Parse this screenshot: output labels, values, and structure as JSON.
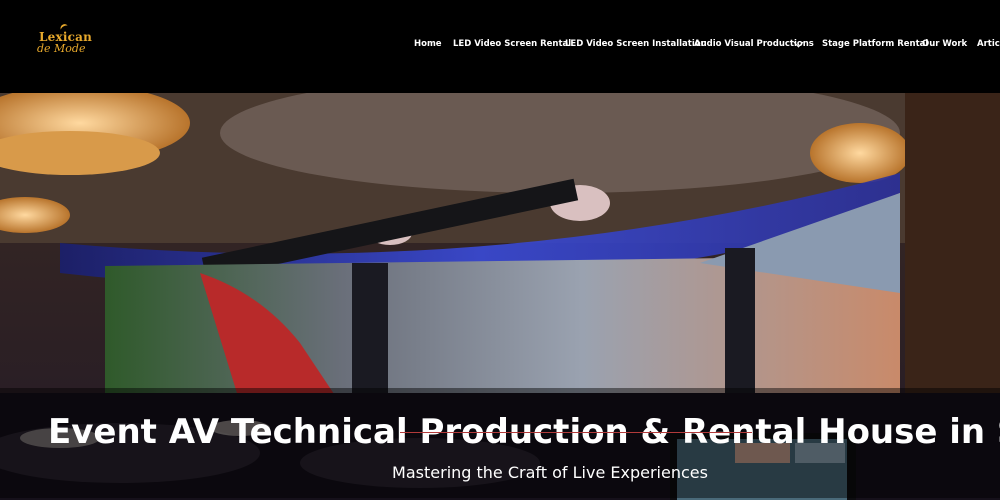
{
  "brand": {
    "logo_line1": "Lexican",
    "logo_line2": "de Mode"
  },
  "nav": {
    "items": [
      {
        "label": "Home"
      },
      {
        "label": "LED Video Screen Rental"
      },
      {
        "label": "LED Video Screen Installation"
      },
      {
        "label": "Audio Visual Productions"
      },
      {
        "label": "Stage Platform Rental"
      },
      {
        "label": "Our Work"
      },
      {
        "label": "Articl"
      }
    ]
  },
  "hero": {
    "title": "Event AV Technical Production & Rental House in Singapo",
    "subtitle": "Mastering the Craft of Live Experiences",
    "accent_color": "#b23a3a"
  },
  "colors": {
    "brand_gold": "#e8a92c",
    "background": "#000000"
  }
}
